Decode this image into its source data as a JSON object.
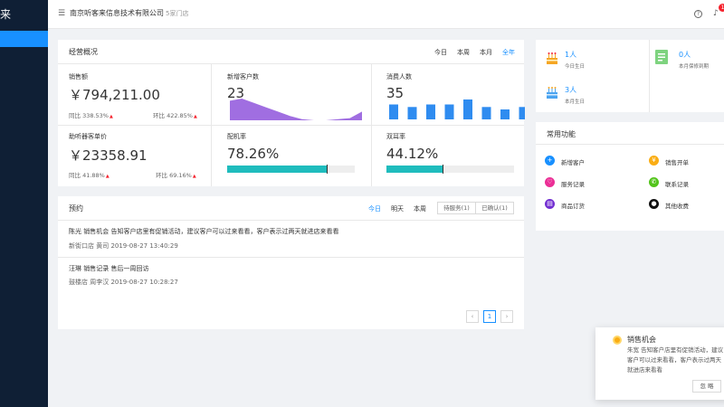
{
  "sidebar": {
    "logo": "来"
  },
  "header": {
    "company": "南京听客来信息技术有限公司",
    "shops": "5家门店",
    "notif_count": "1"
  },
  "overview": {
    "title": "经营概况",
    "tabs": [
      "今日",
      "本周",
      "本月",
      "全年"
    ],
    "active_tab": "全年",
    "metrics": [
      {
        "label": "销售额",
        "value": "￥794,211.00",
        "yoy": "同比 338.53%",
        "mom": "环比 422.85%"
      },
      {
        "label": "新增客户数",
        "value": "23"
      },
      {
        "label": "消费人数",
        "value": "35"
      },
      {
        "label": "助听器客单价",
        "value": "￥23358.91",
        "yoy": "同比 41.88%",
        "mom": "环比 69.16%"
      },
      {
        "label": "配机率",
        "value": "78.26%",
        "percent": 78.26
      },
      {
        "label": "双耳率",
        "value": "44.12%",
        "percent": 44.12
      }
    ]
  },
  "appointments": {
    "title": "预约",
    "tabs": [
      "今日",
      "明天",
      "本周"
    ],
    "active_tab": "今日",
    "filters": [
      "待服务(1)",
      "已确认(1)"
    ],
    "items": [
      {
        "line1": "陈光  销售机会 告知客户店里有促销活动，建议客户可以过来看看，客户表示过两天就进店来看看",
        "line2": "新街口店  黄司  2019-08-27 13:40:29"
      },
      {
        "line1": "汪琳  销售记录 售后一周回访",
        "line2": "鼓楼店  周李汉  2019-08-27 10:28:27"
      }
    ],
    "pagination": {
      "prev": "‹",
      "current": "1",
      "next": "›"
    }
  },
  "reminders": [
    {
      "count": "1人",
      "label": "今日生日",
      "icon": "cake-icon"
    },
    {
      "count": "0人",
      "label": "本月保修到期",
      "icon": "warranty-doc-icon"
    },
    {
      "count": "3人",
      "label": "本月生日",
      "icon": "cake-icon"
    }
  ],
  "quick_functions": {
    "title": "常用功能",
    "items": [
      {
        "label": "新增客户",
        "icon": "plus-icon",
        "color": "#1890ff",
        "glyph": "+"
      },
      {
        "label": "销售开单",
        "icon": "yuan-icon",
        "color": "#faad14",
        "glyph": "¥"
      },
      {
        "label": "服务记录",
        "icon": "service-icon",
        "color": "#eb2f96",
        "glyph": "♡"
      },
      {
        "label": "联系记录",
        "icon": "phone-icon",
        "color": "#52c41a",
        "glyph": "✆"
      },
      {
        "label": "商品订货",
        "icon": "order-icon",
        "color": "#722ed1",
        "glyph": "▤"
      },
      {
        "label": "其他收费",
        "icon": "fee-icon",
        "color": "#111111",
        "glyph": "●"
      }
    ]
  },
  "toast": {
    "title": "销售机会",
    "body": "朱宽 告知客户店里有促销活动，建议客户可以过来看看，客户表示过两天就进店来看看",
    "button": "忽 略"
  },
  "chart_data": [
    {
      "type": "area",
      "title": "新增客户数",
      "x": [
        1,
        2,
        3,
        4,
        5,
        6,
        7,
        8,
        9,
        10,
        11,
        12
      ],
      "values": [
        18,
        20,
        16,
        12,
        8,
        4,
        1,
        0,
        0,
        1,
        2,
        8
      ],
      "color": "#a06ee1"
    },
    {
      "type": "bar",
      "title": "消费人数",
      "x": [
        1,
        2,
        3,
        4,
        5,
        6,
        7,
        8,
        9,
        10,
        11
      ],
      "values": [
        6,
        5,
        6,
        6,
        8,
        5,
        4,
        5,
        7,
        6,
        3
      ],
      "color": "#2f8cf0"
    }
  ],
  "colors": {
    "primary": "#1890ff",
    "sidebar": "#0f1f35",
    "progress": "#1fbcbd",
    "up_arrow": "#f5222d"
  }
}
